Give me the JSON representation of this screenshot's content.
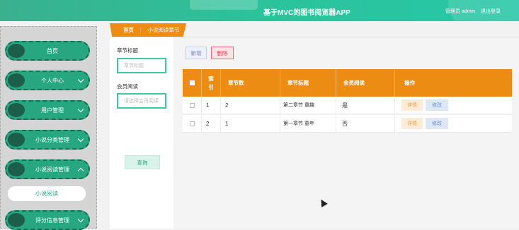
{
  "app": {
    "title": "基于MVC的图书阅览器APP",
    "role": "管理员 admin",
    "logout": "退出登录"
  },
  "sidebar": {
    "items": [
      {
        "label": "首页"
      },
      {
        "label": "个人中心"
      },
      {
        "label": "用户管理"
      },
      {
        "label": "小说分类管理"
      },
      {
        "label": "小说阅读管理"
      },
      {
        "label": "评分信息管理"
      }
    ],
    "subitem": "小说阅读"
  },
  "breadcrumb": {
    "home": "首页",
    "separator": "⋮",
    "current": "小说阅读章节"
  },
  "search": {
    "chapter_label": "章节标题",
    "chapter_placeholder": "章节标题",
    "member_label": "会员阅读",
    "member_placeholder": "请选择会员阅读",
    "query_button": "查询"
  },
  "toolbar": {
    "add": "新增",
    "delete": "删除"
  },
  "table": {
    "headers": [
      "索引",
      "章节数",
      "章节标题",
      "会员阅读",
      "操作"
    ],
    "rows": [
      {
        "index": "1",
        "chapter_num": "2",
        "title": "第二章节 童趣",
        "member": "是"
      },
      {
        "index": "2",
        "chapter_num": "1",
        "title": "第一章节 童年",
        "member": "否"
      }
    ],
    "detail": "详情",
    "edit": "修改"
  },
  "colors": {
    "accent": "#27a77f",
    "header_orange": "#ec8c12",
    "danger": "#d9434f"
  }
}
